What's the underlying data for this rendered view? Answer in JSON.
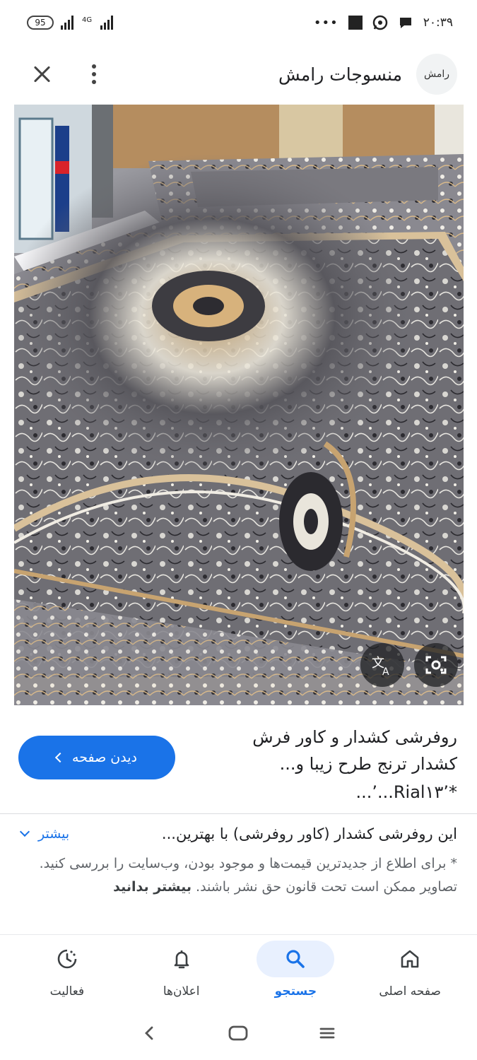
{
  "status_bar": {
    "battery": "95",
    "network": "4G",
    "time": "۲۰:۳۹",
    "overflow": "•••"
  },
  "header": {
    "site_name": "منسوجات رامش",
    "logo_text": "رامش"
  },
  "result": {
    "title": "روفرشی کشدار و کاور فرش کشدار ترنج طرح زیبا و...",
    "price": "*Rial۱۳٬...٬...",
    "visit_label": "دیدن صفحه",
    "description": "این روفرشی کشدار (کاور روفرشی) با بهترین...",
    "more_label": "بیشتر",
    "note": "* برای اطلاع از جدیدترین قیمت‌ها و موجود بودن، وب‌سایت را بررسی کنید. تصاویر ممکن است تحت قانون حق نشر باشند.",
    "note_link": "بیشتر بدانید"
  },
  "bottom_nav": {
    "items": [
      {
        "label": "صفحه اصلی",
        "icon": "home-icon"
      },
      {
        "label": "جستجو",
        "icon": "search-icon"
      },
      {
        "label": "اعلان‌ها",
        "icon": "bell-icon"
      },
      {
        "label": "فعالیت",
        "icon": "activity-icon"
      }
    ]
  },
  "colors": {
    "accent": "#1a73e8",
    "accent_soft": "#e8f0fe",
    "text": "#202124",
    "muted": "#5f6368"
  }
}
